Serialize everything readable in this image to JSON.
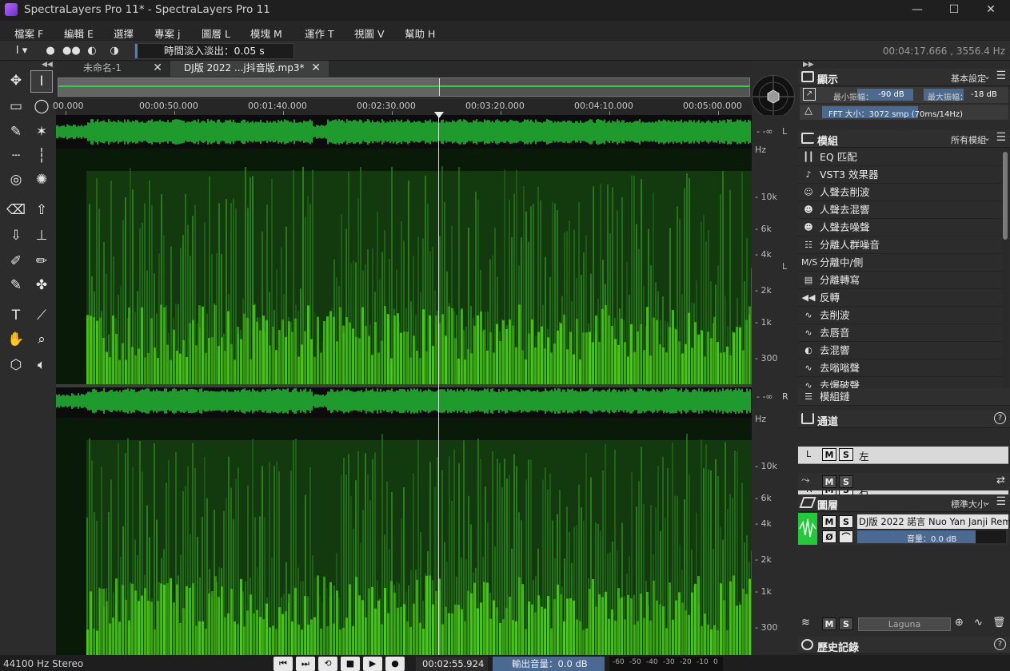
{
  "window": {
    "title": "SpectraLayers Pro 11* - SpectraLayers Pro 11",
    "minimize": "—",
    "maximize": "☐",
    "close": "✕"
  },
  "menu": [
    {
      "label": "檔案 F"
    },
    {
      "label": "編輯 E"
    },
    {
      "label": "選擇"
    },
    {
      "label": "專案 j"
    },
    {
      "label": "圖層 L"
    },
    {
      "label": "模塊 M"
    },
    {
      "label": "運作 T"
    },
    {
      "label": "視圖 V"
    },
    {
      "label": "幫助 H"
    }
  ],
  "tool_options": {
    "fade_label": "時間淡入淡出：0.05 s",
    "cursor_info": "00:04:17.666 , 3556.4 Hz"
  },
  "tabs": [
    {
      "label": "未命名-1",
      "close": "✕"
    },
    {
      "label": "DJ版 2022 ...j抖音版.mp3*",
      "close": "✕"
    }
  ],
  "ruler": [
    "00.000",
    "00:00:50.000",
    "00:01:40.000",
    "00:02:30.000",
    "00:03:20.000",
    "00:04:10.000",
    "00:05:00.000"
  ],
  "freq_labels": [
    "Hz",
    "10k",
    "6k",
    "4k",
    "2k",
    "1k",
    "300"
  ],
  "channel_side": {
    "left": "L",
    "right": "R",
    "db_top": "-∞",
    "db_bot": "-∞"
  },
  "display_panel": {
    "title": "顯示",
    "preset": "基本設定",
    "min_amp_label": "最小振幅：",
    "min_amp_value": "-90 dB",
    "max_amp_label": "最大振幅：",
    "max_amp_value": "-18 dB",
    "fft_label": "FFT 大小：3072 smp (70ms/14Hz)"
  },
  "modules_panel": {
    "title": "模組",
    "filter": "所有模組",
    "items": [
      {
        "label": "EQ 匹配",
        "icon": "eq-match-icon",
        "glyph": "┃┃"
      },
      {
        "label": "VST3 效果器",
        "icon": "vst3-icon",
        "glyph": "♪"
      },
      {
        "label": "人聲去削波",
        "icon": "voice-declip-icon",
        "glyph": "☺"
      },
      {
        "label": "人聲去混響",
        "icon": "voice-dereverb-icon",
        "glyph": "☻"
      },
      {
        "label": "人聲去噪聲",
        "icon": "voice-denoise-icon",
        "glyph": "☻"
      },
      {
        "label": "分離人群噪音",
        "icon": "crowd-noise-icon",
        "glyph": "☷"
      },
      {
        "label": "分離中/側",
        "icon": "mid-side-icon",
        "glyph": "M/S"
      },
      {
        "label": "分離轉寫",
        "icon": "transcription-icon",
        "glyph": "▤"
      },
      {
        "label": "反轉",
        "icon": "reverse-icon",
        "glyph": "◀◀"
      },
      {
        "label": "去削波",
        "icon": "declip-icon",
        "glyph": "∿"
      },
      {
        "label": "去唇音",
        "icon": "demouth-icon",
        "glyph": "∿"
      },
      {
        "label": "去混響",
        "icon": "dereverb-icon",
        "glyph": "◐"
      },
      {
        "label": "去嗡嗡聲",
        "icon": "dehum-icon",
        "glyph": "∿"
      },
      {
        "label": "去爆破聲",
        "icon": "deplosive-icon",
        "glyph": "∿"
      }
    ],
    "chain_label": "模組鏈"
  },
  "channels_panel": {
    "title": "通道",
    "help": "?",
    "rows": [
      {
        "side": "L",
        "name": "左"
      },
      {
        "side": "R",
        "name": "右"
      }
    ],
    "m": "M",
    "s": "S"
  },
  "layers_panel": {
    "title": "圖層",
    "size": "標準大小",
    "layer_name": "DJ版 2022 諾言 Nuo Yan Janji Rem",
    "volume": "音量：0.0 dB",
    "blend_mode": "Laguna",
    "phase": "Ø"
  },
  "history_panel": {
    "title": "歷史記錄",
    "help": "?"
  },
  "status": {
    "format": "44100 Hz Stereo",
    "time": "00:02:55.924",
    "output_label": "輸出音量：0.0 dB",
    "meter_scale": [
      "-60",
      "-50",
      "-40",
      "-30",
      "-20",
      "-10",
      "0"
    ]
  },
  "colors": {
    "accent": "#22c93a",
    "spectrum_bright": "#5ad81e",
    "panel": "#2b2b2b",
    "playhead": "#f0f0f0"
  }
}
